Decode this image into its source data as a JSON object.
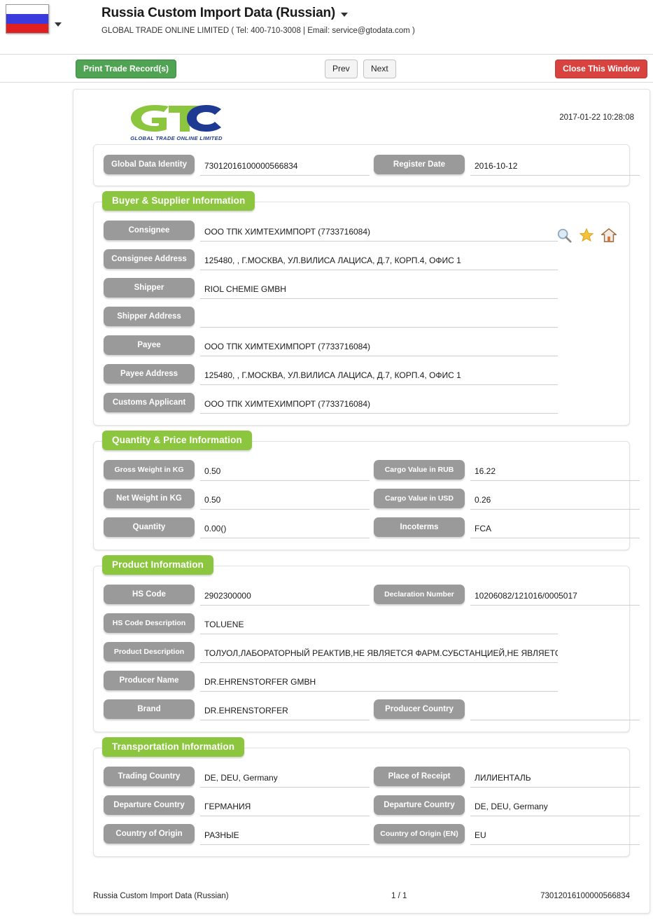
{
  "header": {
    "flag_icon": "russia-flag-icon",
    "lang_caret_icon": "chevron-down-icon",
    "title": "Russia Custom Import Data (Russian)",
    "title_caret_icon": "chevron-down-icon",
    "subtitle": "GLOBAL TRADE ONLINE LIMITED ( Tel: 400-710-3008 | Email: service@gtodata.com )"
  },
  "toolbar": {
    "print_label": "Print Trade Record(s)",
    "prev_label": "Prev",
    "next_label": "Next",
    "close_label": "Close This Window"
  },
  "document": {
    "logo_text": "GTO",
    "logo_tagline": "GLOBAL TRADE  ONLINE LIMITED",
    "stamp_date": "2017-01-22 10:28:08",
    "identity": {
      "id_label": "Global Data Identity",
      "id_value": "73012016100000566834",
      "register_label": "Register Date",
      "register_value": "2016-10-12"
    },
    "sections": [
      {
        "title": "Buyer & Supplier Information",
        "icons": [
          "search-icon",
          "star-icon",
          "home-icon"
        ],
        "rows": [
          {
            "layout": "single",
            "label": "Consignee",
            "value": "ООО ТПК ХИМТЕХИМПОРТ (7733716084)"
          },
          {
            "layout": "single",
            "label": "Consignee Address",
            "value": "125480, , Г.МОСКВА, УЛ.ВИЛИСА ЛАЦИСА, Д.7, КОРП.4, ОФИС 1"
          },
          {
            "layout": "single",
            "label": "Shipper",
            "value": "RIOL CHEMIE GMBH"
          },
          {
            "layout": "single",
            "label": "Shipper Address",
            "value": ""
          },
          {
            "layout": "single",
            "label": "Payee",
            "value": "ООО ТПК ХИМТЕХИМПОРТ  (7733716084)"
          },
          {
            "layout": "single",
            "label": "Payee Address",
            "value": "125480, , Г.МОСКВА, УЛ.ВИЛИСА ЛАЦИСА, Д.7, КОРП.4, ОФИС 1"
          },
          {
            "layout": "single",
            "label": "Customs Applicant",
            "value": "ООО ТПК ХИМТЕХИМПОРТ  (7733716084)"
          }
        ]
      },
      {
        "title": "Quantity & Price Information",
        "icons": [],
        "rows": [
          {
            "layout": "double",
            "label": "Gross Weight in KG",
            "value": "0.50",
            "label2": "Cargo Value in RUB",
            "value2": "16.22"
          },
          {
            "layout": "double",
            "label": "Net Weight in KG",
            "value": "0.50",
            "label2": "Cargo Value in USD",
            "value2": "0.26"
          },
          {
            "layout": "double",
            "label": "Quantity",
            "value": "0.00()",
            "label2": "Incoterms",
            "value2": "FCA"
          }
        ]
      },
      {
        "title": "Product Information",
        "icons": [],
        "rows": [
          {
            "layout": "double",
            "label": "HS Code",
            "value": "2902300000",
            "label2": "Declaration Number",
            "value2": "10206082/121016/0005017"
          },
          {
            "layout": "single",
            "label": "HS Code Description",
            "value": "TOLUENE"
          },
          {
            "layout": "single",
            "label": "Product Description",
            "value": "ТОЛУОЛ,ЛАБОРАТОРНЫЙ РЕАКТИВ,НЕ ЯВЛЯЕТСЯ ФАРМ.СУБСТАНЦИЕЙ,НЕ ЯВЛЯЕТСЯ"
          },
          {
            "layout": "single",
            "label": "Producer Name",
            "value": "DR.EHRENSTORFER GMBH"
          },
          {
            "layout": "double",
            "label": "Brand",
            "value": "DR.EHRENSTORFER",
            "label2": "Producer Country",
            "value2": ""
          }
        ]
      },
      {
        "title": "Transportation Information",
        "icons": [],
        "rows": [
          {
            "layout": "double",
            "label": "Trading Country",
            "value": "DE, DEU, Germany",
            "label2": "Place of Receipt",
            "value2": "ЛИЛИЕНТАЛЬ"
          },
          {
            "layout": "double",
            "label": "Departure Country",
            "value": "ГЕРМАНИЯ",
            "label2": "Departure Country",
            "value2": "DE, DEU, Germany"
          },
          {
            "layout": "double",
            "label": "Country of Origin",
            "value": "РАЗНЫЕ",
            "label2": "Country of Origin (EN)",
            "value2": "EU"
          }
        ]
      }
    ],
    "footer": {
      "left": "Russia Custom Import Data (Russian)",
      "middle": "1 / 1",
      "right": "73012016100000566834"
    }
  },
  "colors": {
    "accent_green": "#8cc63e",
    "pill_gray": "#9a9a9a",
    "print_green": "#4fa352",
    "close_red": "#d9433f",
    "logo_blue": "#1f3a93"
  }
}
